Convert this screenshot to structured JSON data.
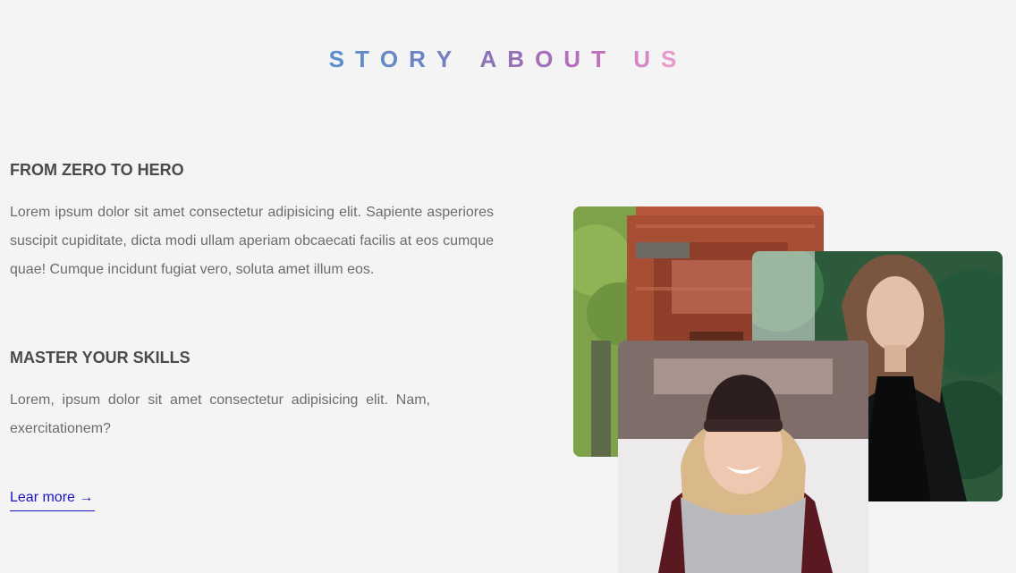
{
  "header": {
    "title_letters": [
      {
        "ch": "S",
        "color": "#5a8fcc"
      },
      {
        "ch": "T",
        "color": "#5f8bca"
      },
      {
        "ch": "O",
        "color": "#6688c7"
      },
      {
        "ch": "R",
        "color": "#6c84c5"
      },
      {
        "ch": "Y",
        "color": "#7280c2"
      },
      {
        "ch": " ",
        "color": "#7880c0"
      },
      {
        "ch": "A",
        "color": "#8a73b7"
      },
      {
        "ch": "B",
        "color": "#9670b6"
      },
      {
        "ch": "O",
        "color": "#a56eb8"
      },
      {
        "ch": "U",
        "color": "#b56ebc"
      },
      {
        "ch": "T",
        "color": "#c06dbd"
      },
      {
        "ch": " ",
        "color": "#ca75c2"
      },
      {
        "ch": "U",
        "color": "#d686c7"
      },
      {
        "ch": "S",
        "color": "#e59acc"
      }
    ]
  },
  "sections": [
    {
      "heading": "FROM ZERO TO HERO",
      "body": "Lorem ipsum dolor sit amet consectetur adipisicing elit. Sapiente asperiores suscipit cupiditate, dicta modi ullam aperiam obcaecati facilis at eos cumque quae! Cumque incidunt fugiat vero, soluta amet illum eos."
    },
    {
      "heading": "MASTER YOUR SKILLS",
      "body": "Lorem, ipsum dolor sit amet consectetur adipisicing elit. Nam, exercitationem?"
    }
  ],
  "cta": {
    "label": "Lear more →"
  },
  "colors": {
    "background": "#f4f4f4",
    "link": "#1a12c8",
    "heading": "#4a4a4a",
    "body_text": "#6c6c6c"
  }
}
